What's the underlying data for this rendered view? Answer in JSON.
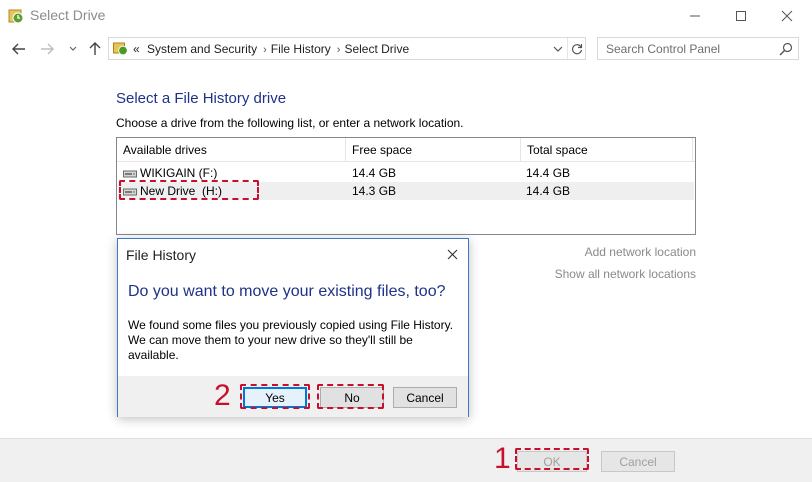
{
  "window": {
    "title": "Select Drive"
  },
  "navigation": {
    "breadcrumbs": [
      "System and Security",
      "File History",
      "Select Drive"
    ],
    "breadcrumb_overflow": "«",
    "search_placeholder": "Search Control Panel"
  },
  "main": {
    "heading": "Select a File History drive",
    "subtitle": "Choose a drive from the following list, or enter a network location.",
    "columns": [
      "Available drives",
      "Free space",
      "Total space"
    ],
    "drives": [
      {
        "name": "WIKIGAIN (F:)",
        "free": "14.4 GB",
        "total": "14.4 GB"
      },
      {
        "name": "New Drive  (H:)",
        "free": "14.3 GB",
        "total": "14.4 GB"
      }
    ],
    "links": {
      "add_network": "Add network location",
      "show_all": "Show all network locations"
    }
  },
  "footer": {
    "ok_label": "OK",
    "cancel_label": "Cancel"
  },
  "dialog": {
    "title": "File History",
    "question": "Do you want to move your existing files, too?",
    "body": "We found some files you previously copied using File History. We can move them to your new drive so they'll still be available.",
    "yes_label": "Yes",
    "no_label": "No",
    "cancel_label": "Cancel"
  },
  "annotations": {
    "step1": "1",
    "step2": "2",
    "marker_color": "#c8102e"
  },
  "colors": {
    "heading": "#1e3287",
    "dialog_border": "#3c78c8",
    "focus": "#0078d7"
  }
}
